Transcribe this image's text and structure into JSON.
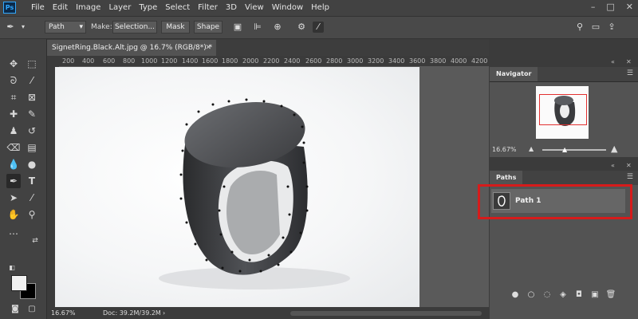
{
  "app": {
    "logo": "Ps"
  },
  "menu": [
    "File",
    "Edit",
    "Image",
    "Layer",
    "Type",
    "Select",
    "Filter",
    "3D",
    "View",
    "Window",
    "Help"
  ],
  "window_controls": [
    "–",
    "□",
    "✕"
  ],
  "options_bar": {
    "tool_mode": "Path",
    "make_label": "Make:",
    "selection_label": "Selection...",
    "mask_label": "Mask",
    "shape_label": "Shape"
  },
  "document": {
    "tab_title": "SignetRing.Black.Alt.jpg @ 16.7% (RGB/8*) *",
    "zoom": "16.67%",
    "doc_size": "Doc: 39.2M/39.2M"
  },
  "ruler": {
    "h_ticks": [
      "200",
      "400",
      "600",
      "800",
      "1000",
      "1200",
      "1400",
      "1600",
      "1800",
      "2000",
      "2200",
      "2400",
      "2600",
      "2800",
      "3000",
      "3200",
      "3400",
      "3600",
      "3800",
      "4000",
      "4200"
    ]
  },
  "navigator": {
    "title": "Navigator",
    "zoom": "16.67%"
  },
  "paths": {
    "title": "Paths",
    "items": [
      {
        "name": "Path 1"
      }
    ]
  },
  "colors": {
    "accent": "#31a8ff",
    "highlight": "#d61b1b"
  }
}
